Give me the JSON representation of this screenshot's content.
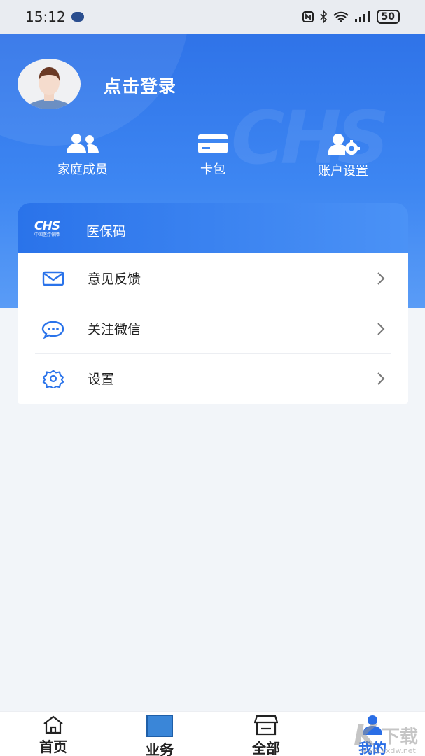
{
  "status_bar": {
    "time": "15:12",
    "battery": "50",
    "icons": [
      "nfc-icon",
      "bluetooth-icon",
      "wifi-icon",
      "signal-icon",
      "battery-icon"
    ]
  },
  "profile": {
    "login_text": "点击登录"
  },
  "quick_actions": [
    {
      "label": "家庭成员",
      "icon": "family-members-icon"
    },
    {
      "label": "卡包",
      "icon": "card-wallet-icon"
    },
    {
      "label": "账户设置",
      "icon": "account-settings-icon"
    }
  ],
  "hero_watermark": "CHS",
  "insurance_card": {
    "logo_text": "CHS",
    "logo_sub": "中国医疗保障",
    "title": "医保码"
  },
  "menu": [
    {
      "label": "意见反馈",
      "icon": "mail-icon"
    },
    {
      "label": "关注微信",
      "icon": "chat-bubble-icon"
    },
    {
      "label": "设置",
      "icon": "gear-icon"
    }
  ],
  "tabbar": {
    "tabs": [
      {
        "label": "首页",
        "icon": "home-icon",
        "active": false
      },
      {
        "label": "业务",
        "icon": "business-icon",
        "active": false
      },
      {
        "label": "全部",
        "icon": "store-icon",
        "active": false
      },
      {
        "label": "我的",
        "icon": "user-icon",
        "active": true
      }
    ]
  },
  "corner_watermark": {
    "letter": "K",
    "text": "下载",
    "url": "www.kxdw.net"
  },
  "colors": {
    "primary": "#2f73e8",
    "active_tab": "#2a6ee6",
    "background": "#f2f5f9"
  }
}
